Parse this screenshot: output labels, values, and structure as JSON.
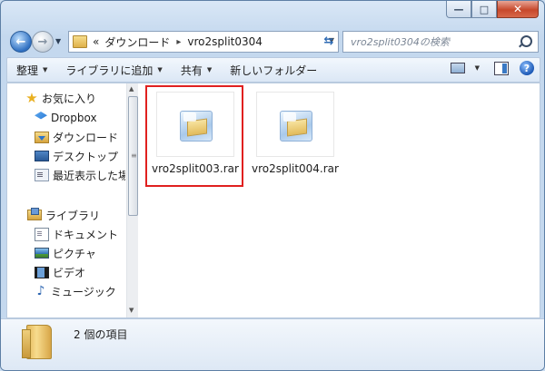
{
  "window": {
    "caption_buttons": {
      "minimize_glyph": "—",
      "maximize_glyph": "□",
      "close_glyph": "✕"
    }
  },
  "nav": {
    "back_glyph": "←",
    "forward_glyph": "→",
    "refresh_glyph": "⇆"
  },
  "address": {
    "overflow": "«",
    "segments": [
      "ダウンロード",
      "vro2split0304"
    ],
    "separator": "▸"
  },
  "search": {
    "placeholder": "vro2split0304の検索"
  },
  "toolbar": {
    "items": [
      "整理",
      "ライブラリに追加",
      "共有",
      "新しいフォルダー"
    ],
    "help_glyph": "?"
  },
  "sidebar": {
    "favorites": {
      "label": "お気に入り",
      "icon": "star-icon"
    },
    "favorite_items": [
      {
        "label": "Dropbox",
        "icon": "dropbox-icon"
      },
      {
        "label": "ダウンロード",
        "icon": "download-folder-icon"
      },
      {
        "label": "デスクトップ",
        "icon": "desktop-icon"
      },
      {
        "label": "最近表示した場所",
        "icon": "recent-places-icon"
      }
    ],
    "libraries": {
      "label": "ライブラリ",
      "icon": "library-icon"
    },
    "library_items": [
      {
        "label": "ドキュメント",
        "icon": "documents-icon"
      },
      {
        "label": "ピクチャ",
        "icon": "pictures-icon"
      },
      {
        "label": "ビデオ",
        "icon": "videos-icon"
      },
      {
        "label": "ミュージック",
        "icon": "music-icon"
      }
    ],
    "scroll": {
      "up_glyph": "▲",
      "down_glyph": "▼",
      "grip_glyph": "≡"
    }
  },
  "files": [
    {
      "name": "vro2split003.rar",
      "icon": "rar-archive-icon",
      "highlighted": true
    },
    {
      "name": "vro2split004.rar",
      "icon": "rar-archive-icon",
      "highlighted": false
    }
  ],
  "details": {
    "status": "2 個の項目"
  },
  "colors": {
    "highlight_border": "#e0201f",
    "window_frame": "#c4d8ee"
  }
}
